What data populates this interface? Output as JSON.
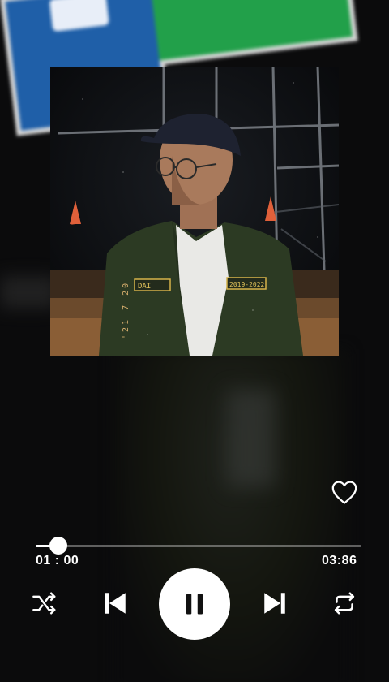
{
  "player": {
    "current_time": "01 : 00",
    "duration": "03:86",
    "progress": 0.07,
    "is_playing": true,
    "liked": false
  },
  "cover": {
    "date_stamp": "'21 7 20"
  },
  "icons": {
    "like": "heart-outline-icon",
    "shuffle": "shuffle-icon",
    "previous": "skip-previous-icon",
    "play_pause": "pause-icon",
    "next": "skip-next-icon",
    "repeat": "repeat-icon"
  },
  "colors": {
    "accent": "#ffffff",
    "background": "#0b0b0c",
    "track": "#8a8a8a"
  }
}
